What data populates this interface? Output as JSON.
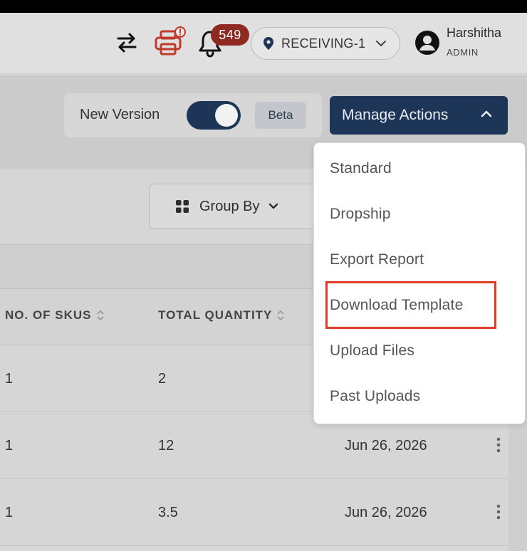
{
  "header": {
    "notifications_count": "549",
    "location_label": "RECEIVING-1",
    "user_name": "Harshitha",
    "user_role": "ADMIN"
  },
  "toolbar": {
    "new_version_label": "New Version",
    "new_version_enabled": true,
    "beta_label": "Beta",
    "manage_actions_label": "Manage Actions"
  },
  "filters": {
    "group_by_label": "Group By"
  },
  "table": {
    "columns": [
      "NO. OF SKUS",
      "TOTAL QUANTITY"
    ],
    "rows": [
      {
        "skus": "1",
        "quantity": "2",
        "date": ""
      },
      {
        "skus": "1",
        "quantity": "12",
        "date": "Jun 26, 2026"
      },
      {
        "skus": "1",
        "quantity": "3.5",
        "date": "Jun 26, 2026"
      }
    ]
  },
  "manage_menu": {
    "items": [
      "Standard",
      "Dropship",
      "Export Report",
      "Download Template",
      "Upload Files",
      "Past Uploads"
    ],
    "highlighted": "Download Template"
  },
  "colors": {
    "primary": "#1d3557",
    "badge": "#8f2a23",
    "printer_icon": "#c0392b",
    "highlight_border": "#e03c2a"
  },
  "icons": [
    "transfer-icon",
    "printer-icon",
    "bell-icon",
    "location-pin-icon",
    "chevron-down-icon",
    "user-avatar-icon",
    "chevron-up-icon",
    "grid-icon",
    "sort-icon",
    "kebab-icon"
  ]
}
